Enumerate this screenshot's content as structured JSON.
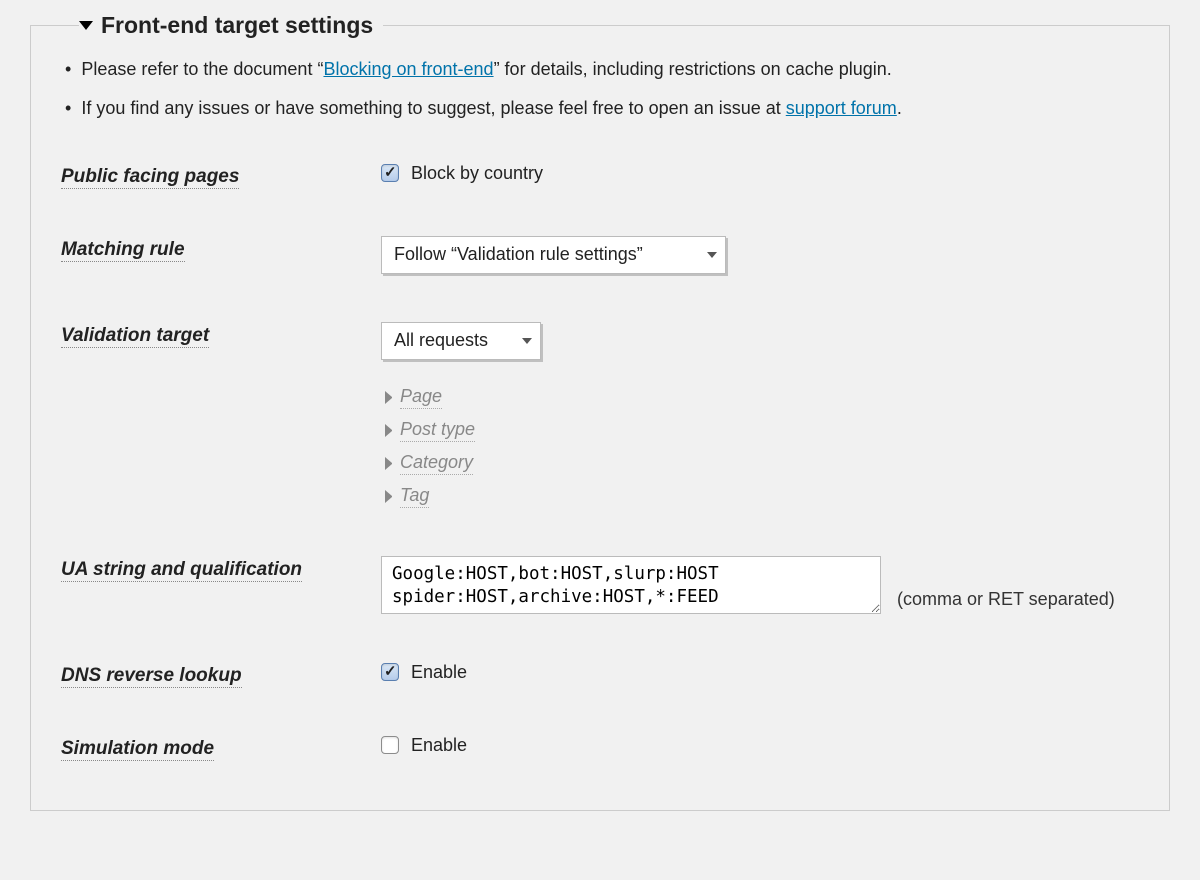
{
  "panel": {
    "title": "Front-end target settings"
  },
  "notes": {
    "item1_prefix": "Please refer to the document “",
    "item1_link": "Blocking on front-end",
    "item1_suffix": "” for details, including restrictions on cache plugin.",
    "item2_prefix": "If you find any issues or have something to suggest, please feel free to open an issue at ",
    "item2_link": "support forum",
    "item2_suffix": "."
  },
  "fields": {
    "public_facing": {
      "label": "Public facing pages",
      "checkbox_label": "Block by country",
      "checked": true
    },
    "matching_rule": {
      "label": "Matching rule",
      "value": "Follow “Validation rule settings”"
    },
    "validation_target": {
      "label": "Validation target",
      "value": "All requests",
      "expands": [
        "Page",
        "Post type",
        "Category",
        "Tag"
      ]
    },
    "ua_string": {
      "label": "UA string and qualification",
      "value": "Google:HOST,bot:HOST,slurp:HOST\nspider:HOST,archive:HOST,*:FEED",
      "hint": "(comma or RET separated)"
    },
    "dns_reverse": {
      "label": "DNS reverse lookup",
      "checkbox_label": "Enable",
      "checked": true
    },
    "simulation": {
      "label": "Simulation mode",
      "checkbox_label": "Enable",
      "checked": false
    }
  }
}
